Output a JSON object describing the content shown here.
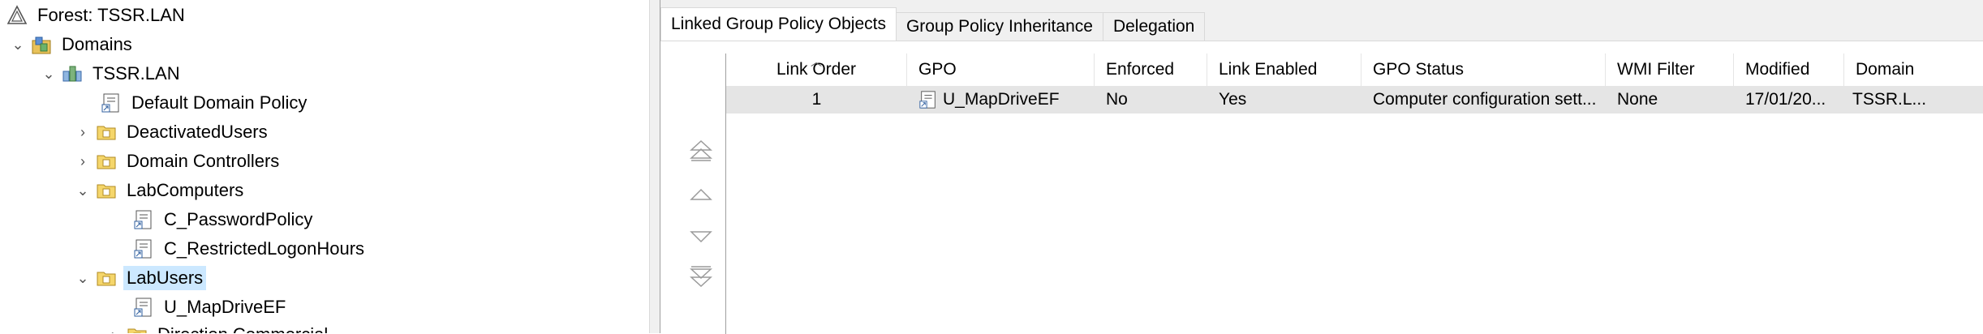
{
  "tree": {
    "forest": "Forest: TSSR.LAN",
    "domains": "Domains",
    "domain": "TSSR.LAN",
    "default_policy": "Default Domain Policy",
    "deactivated_users": "DeactivatedUsers",
    "domain_controllers": "Domain Controllers",
    "lab_computers": "LabComputers",
    "c_password_policy": "C_PasswordPolicy",
    "c_restricted_logon": "C_RestrictedLogonHours",
    "lab_users": "LabUsers",
    "u_mapdrive": "U_MapDriveEF",
    "direction_commercial": "Direction Commercial"
  },
  "tabs": {
    "linked": "Linked Group Policy Objects",
    "inheritance": "Group Policy Inheritance",
    "delegation": "Delegation"
  },
  "grid": {
    "headers": {
      "link_order": "Link Order",
      "gpo": "GPO",
      "enforced": "Enforced",
      "link_enabled": "Link Enabled",
      "gpo_status": "GPO Status",
      "wmi_filter": "WMI Filter",
      "modified": "Modified",
      "domain": "Domain"
    },
    "rows": [
      {
        "link_order": "1",
        "gpo": "U_MapDriveEF",
        "enforced": "No",
        "link_enabled": "Yes",
        "gpo_status": "Computer configuration sett...",
        "wmi_filter": "None",
        "modified": "17/01/20...",
        "domain": "TSSR.L..."
      }
    ]
  },
  "colors": {
    "selection": "#cce8ff",
    "row_highlight": "#e5e5e5",
    "pane_bg": "#f0f0f0"
  }
}
